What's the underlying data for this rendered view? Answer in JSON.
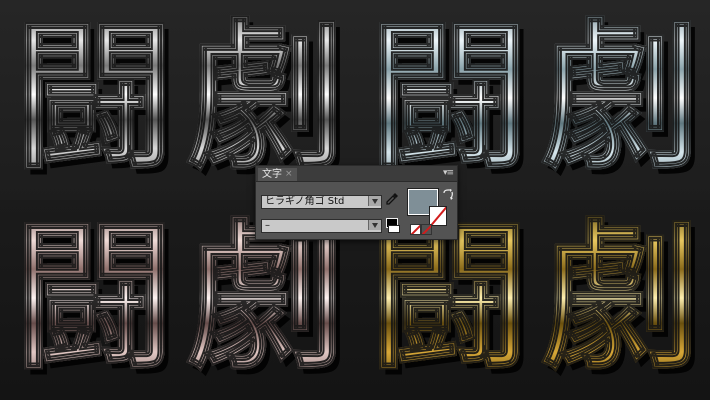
{
  "artwork": {
    "glyphs": [
      "闘",
      "劇"
    ],
    "variants": [
      {
        "name": "silver",
        "colors": [
          "#5a5a5a",
          "#ffffff"
        ]
      },
      {
        "name": "steel",
        "colors": [
          "#6f8890",
          "#eef6fa"
        ]
      },
      {
        "name": "rose",
        "colors": [
          "#6e5553",
          "#fff4f2"
        ]
      },
      {
        "name": "gold",
        "colors": [
          "#5e4a10",
          "#fff0b0"
        ]
      }
    ]
  },
  "panel": {
    "tab_label": "文字",
    "close_glyph": "×",
    "menu_glyph": "▾≡",
    "font_family_value": "ヒラギノ角ゴ Std",
    "font_style_value": "–",
    "fill_color": "#7f8f97",
    "icons": {
      "eyedropper": "eyedropper-icon",
      "swap": "swap-fill-stroke-icon"
    }
  }
}
